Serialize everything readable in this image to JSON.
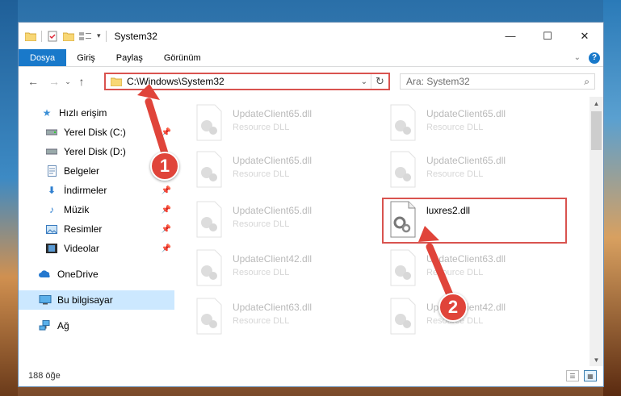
{
  "window": {
    "title": "System32",
    "minimize_glyph": "—",
    "maximize_glyph": "☐",
    "close_glyph": "✕"
  },
  "ribbon": {
    "tabs": [
      {
        "label": "Dosya"
      },
      {
        "label": "Giriş"
      },
      {
        "label": "Paylaş"
      },
      {
        "label": "Görünüm"
      }
    ],
    "help_label": "?"
  },
  "address": {
    "path": "C:\\Windows\\System32",
    "search_placeholder": "Ara: System32"
  },
  "sidebar": {
    "items": [
      {
        "label": "Hızlı erişim",
        "icon": "star-icon",
        "pinned": false
      },
      {
        "label": "Yerel Disk (C:)",
        "icon": "drive-icon",
        "pinned": true
      },
      {
        "label": "Yerel Disk (D:)",
        "icon": "drive-icon",
        "pinned": false
      },
      {
        "label": "Belgeler",
        "icon": "document-icon",
        "pinned": true
      },
      {
        "label": "İndirmeler",
        "icon": "download-icon",
        "pinned": true
      },
      {
        "label": "Müzik",
        "icon": "music-icon",
        "pinned": true
      },
      {
        "label": "Resimler",
        "icon": "picture-icon",
        "pinned": true
      },
      {
        "label": "Videolar",
        "icon": "video-icon",
        "pinned": true
      },
      {
        "label": "OneDrive",
        "icon": "cloud-icon",
        "pinned": false
      },
      {
        "label": "Bu bilgisayar",
        "icon": "computer-icon",
        "pinned": false
      },
      {
        "label": "Ağ",
        "icon": "network-icon",
        "pinned": false
      }
    ]
  },
  "files": [
    {
      "name": "UpdateClient65.dll",
      "type": "Resource DLL"
    },
    {
      "name": "UpdateClient65.dll",
      "type": "Resource DLL"
    },
    {
      "name": "UpdateClient65.dll",
      "type": "Resource DLL"
    },
    {
      "name": "UpdateClient65.dll",
      "type": "Resource DLL"
    },
    {
      "name": "UpdateClient65.dll",
      "type": "Resource DLL"
    },
    {
      "name": "luxres2.dll",
      "type": ""
    },
    {
      "name": "UpdateClient42.dll",
      "type": "Resource DLL"
    },
    {
      "name": "UpdateClient63.dll",
      "type": "Resource DLL"
    },
    {
      "name": "UpdateClient63.dll",
      "type": "Resource DLL"
    },
    {
      "name": "UpdateClient42.dll",
      "type": "Resource DLL"
    }
  ],
  "status": {
    "item_count": "188 öğe"
  },
  "annotations": {
    "step1": "1",
    "step2": "2"
  },
  "colors": {
    "accent": "#1979ca",
    "highlight_red": "#d9534f",
    "selected_bg": "#cce8ff"
  }
}
